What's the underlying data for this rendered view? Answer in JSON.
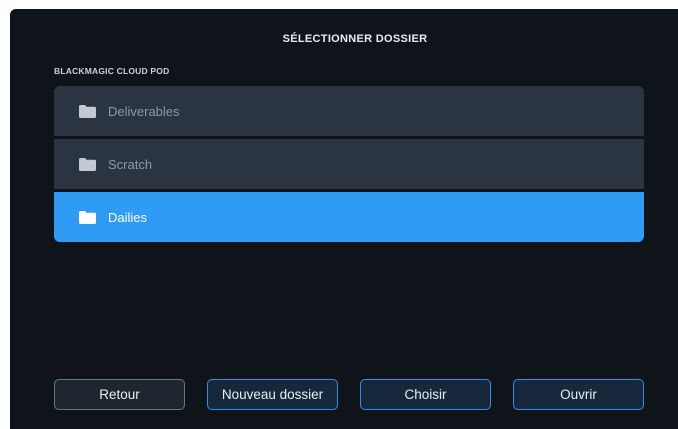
{
  "dialog": {
    "title": "SÉLECTIONNER DOSSIER",
    "location_label": "BLACKMAGIC CLOUD POD"
  },
  "folders": [
    {
      "name": "Deliverables",
      "icon": "folder-icon",
      "selected": false
    },
    {
      "name": "Scratch",
      "icon": "folder-icon",
      "selected": false
    },
    {
      "name": "Dailies",
      "icon": "folder-icon",
      "selected": true
    }
  ],
  "buttons": {
    "back": "Retour",
    "new_folder": "Nouveau dossier",
    "choose": "Choisir",
    "open": "Ouvrir"
  },
  "colors": {
    "background": "#0f141b",
    "row": "#2b3541",
    "selected_row": "#2f9bf5",
    "accent_border": "#2f8fe8"
  }
}
